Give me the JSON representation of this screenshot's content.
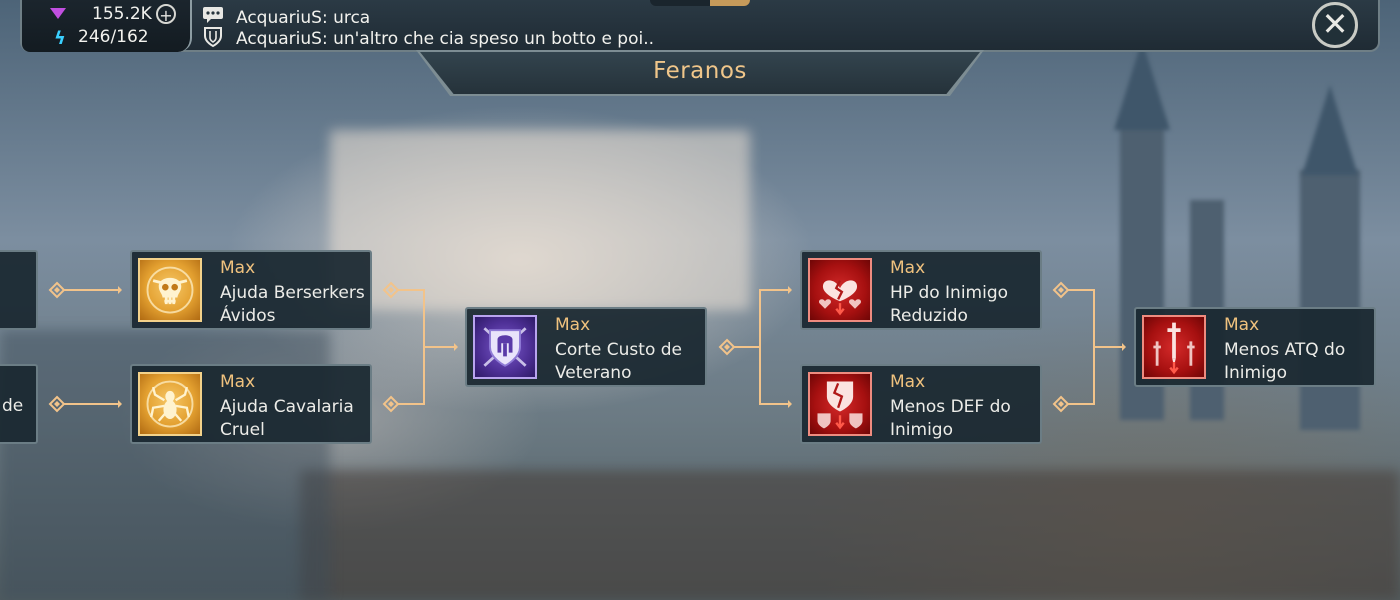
{
  "resources": {
    "gems": "155.2K",
    "energy": "246/162"
  },
  "chat": [
    {
      "user": "AcquariuS",
      "text": "AcquariuS: urca"
    },
    {
      "user": "AcquariuS",
      "text": "AcquariuS: un'altro che cia speso un botto e poi.."
    }
  ],
  "title": "Feranos",
  "nodes": {
    "partial_top": {
      "name": ""
    },
    "partial_bottom": {
      "name": "de"
    },
    "berserkers": {
      "level": "Max",
      "name": "Ajuda Berserkers Ávidos",
      "icon": "skull-icon"
    },
    "cavalaria": {
      "level": "Max",
      "name": "Ajuda Cavalaria Cruel",
      "icon": "spider-icon"
    },
    "veterano": {
      "level": "Max",
      "name": "Corte Custo de Veterano",
      "icon": "helmet-shield-icon"
    },
    "hp": {
      "level": "Max",
      "name": "HP do Inimigo Reduzido",
      "icon": "broken-heart-icon"
    },
    "def": {
      "level": "Max",
      "name": "Menos DEF do Inimigo",
      "icon": "broken-shield-icon"
    },
    "atq": {
      "level": "Max",
      "name": "Menos ATQ do Inimigo",
      "icon": "swords-icon"
    }
  },
  "colors": {
    "accent": "#f0c27e",
    "connector": "#f2c38a",
    "panel": "#1a2830"
  }
}
